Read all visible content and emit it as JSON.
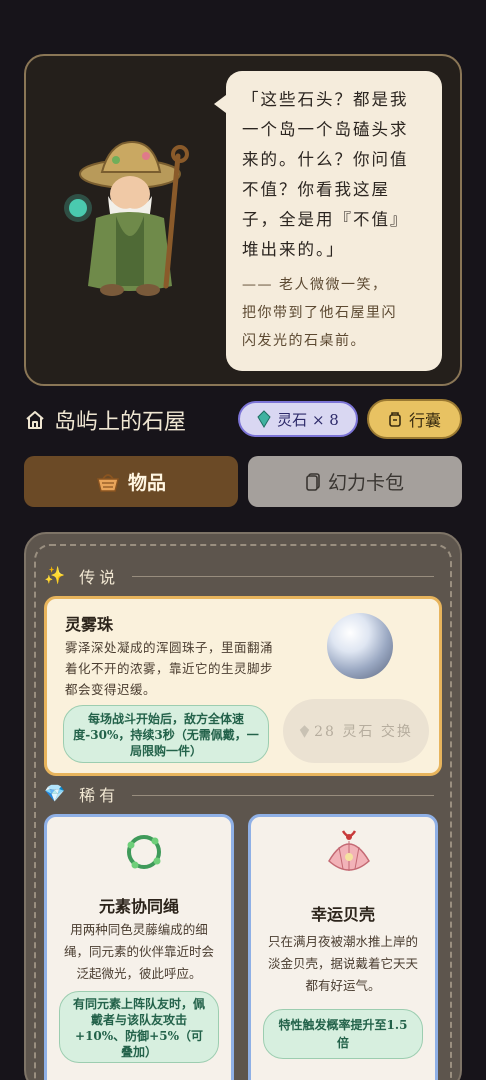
{
  "dialog": {
    "quote": "「这些石头？都是我\n一个岛一个岛磕头求\n来的。什么？你问值\n不值？你看我这屋\n子，全是用『不值』\n堆出来的。」",
    "narration": "—— 老人微微一笑，\n把你带到了他石屋里闪\n闪发光的石桌前。"
  },
  "header": {
    "title": "岛屿上的石屋",
    "stone_counter": "灵石 × 8",
    "bag_label": "行囊"
  },
  "tabs": [
    {
      "label": "物品",
      "active": true
    },
    {
      "label": "幻力卡包",
      "active": false
    }
  ],
  "sections": {
    "legendary": "传说",
    "rare": "稀有"
  },
  "items": {
    "legendary": {
      "name": "灵雾珠",
      "description": "雾泽深处凝成的浑圆珠子，里面翻涌着化不开的浓雾，靠近它的生灵脚步都会变得迟缓。",
      "effect": "每场战斗开始后，敌方全体速度-30%，持续3秒（无需佩戴，一局限购一件）",
      "price_label": "28 灵石 交换"
    },
    "rare": [
      {
        "name": "元素协同绳",
        "description": "用两种同色灵藤编成的细绳，同元素的伙伴靠近时会泛起微光，彼此呼应。",
        "effect": "有同元素上阵队友时，佩戴者与该队友攻击+10%、防御+5%（可叠加）"
      },
      {
        "name": "幸运贝壳",
        "description": "只在满月夜被潮水推上岸的淡金贝壳，据说戴着它天天都有好运气。",
        "effect": "特性触发概率提升至1.5倍"
      }
    ]
  },
  "colors": {
    "accent_gold": "#e8c262",
    "tab_active": "#6b4a26",
    "legend_border": "#e7b45c",
    "rare_border": "#8fb0e6"
  },
  "icons": [
    "home-icon",
    "spirit-stone-icon",
    "bag-icon",
    "basket-icon",
    "card-pack-icon",
    "sparkles-icon",
    "gem-icon"
  ]
}
